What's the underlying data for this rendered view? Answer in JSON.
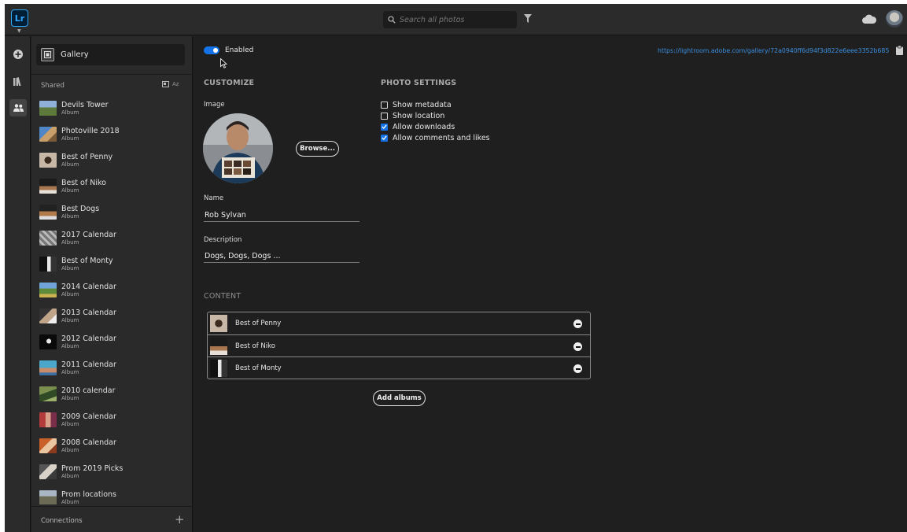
{
  "topbar": {
    "logo": "Lr",
    "search_placeholder": "Search all photos",
    "icons": [
      "search-icon",
      "filter-icon",
      "cloud-icon",
      "user-avatar"
    ]
  },
  "rail": {
    "icons": [
      "add-icon",
      "library-icon",
      "people-icon"
    ]
  },
  "sidebar": {
    "gallery_label": "Gallery",
    "shared_label": "Shared",
    "sort_label": "Az",
    "albums": [
      {
        "name": "Devils Tower",
        "type": "Album"
      },
      {
        "name": "Photoville 2018",
        "type": "Album"
      },
      {
        "name": "Best of Penny",
        "type": "Album"
      },
      {
        "name": "Best of Niko",
        "type": "Album"
      },
      {
        "name": "Best Dogs",
        "type": "Album"
      },
      {
        "name": "2017 Calendar",
        "type": "Album"
      },
      {
        "name": "Best of Monty",
        "type": "Album"
      },
      {
        "name": "2014 Calendar",
        "type": "Album"
      },
      {
        "name": "2013 Calendar",
        "type": "Album"
      },
      {
        "name": "2012 Calendar",
        "type": "Album"
      },
      {
        "name": "2011 Calendar",
        "type": "Album"
      },
      {
        "name": "2010 calendar",
        "type": "Album"
      },
      {
        "name": "2009 Calendar",
        "type": "Album"
      },
      {
        "name": "2008 Calendar",
        "type": "Album"
      },
      {
        "name": "Prom 2019 Picks",
        "type": "Album"
      },
      {
        "name": "Prom locations",
        "type": "Album"
      }
    ],
    "connections_label": "Connections"
  },
  "main": {
    "enabled_label": "Enabled",
    "enabled": true,
    "url": "https://lightroom.adobe.com/gallery/72a0940ff6d94f3d822e6eee3352b685",
    "customize_header": "CUSTOMIZE",
    "image_label": "Image",
    "browse_label": "Browse...",
    "name_label": "Name",
    "name_value": "Rob Sylvan",
    "description_label": "Description",
    "description_value": "Dogs, Dogs, Dogs ...",
    "photo_settings_header": "PHOTO SETTINGS",
    "photo_settings": [
      {
        "label": "Show metadata",
        "checked": false
      },
      {
        "label": "Show location",
        "checked": false
      },
      {
        "label": "Allow downloads",
        "checked": true
      },
      {
        "label": "Allow comments and likes",
        "checked": true
      }
    ],
    "content_header": "CONTENT",
    "content_albums": [
      "Best of Penny",
      "Best of Niko",
      "Best of Monty"
    ],
    "add_albums_label": "Add albums"
  },
  "colors": {
    "accent": "#1473e6",
    "link": "#3b8fe0",
    "background": "#1f1f1f",
    "panel": "#2a2a2a"
  }
}
